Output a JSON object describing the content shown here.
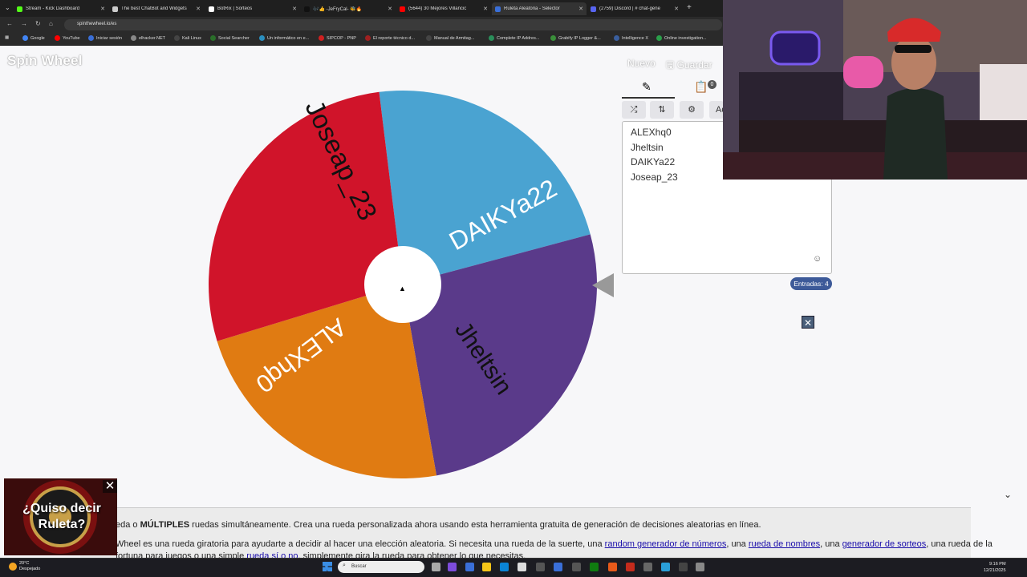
{
  "browser": {
    "tabs": [
      {
        "title": "Stream - Kick Dashboard",
        "color": "#53fc18"
      },
      {
        "title": "The best ChatBot and Widgets",
        "color": "#cccccc"
      },
      {
        "title": "BotRix | Sorteos",
        "color": "#ffffff"
      },
      {
        "title": "🎶👍 -JeFryCal- 🐝🔥",
        "color": "#111111"
      },
      {
        "title": "(5644) 30 Mejores Villancic",
        "color": "#ff0000"
      },
      {
        "title": "Ruleta Aleatoria - Selector",
        "color": "#3a6fd8"
      },
      {
        "title": "(2759) Discord | # chat-gene",
        "color": "#5865f2"
      }
    ],
    "url": "spinthewheel.io/es",
    "bookmarks": [
      "Google",
      "YouTube",
      "Iniciar sesión",
      "elhacker.NET",
      "Kali Linux",
      "Social Searcher",
      "Un informático en e...",
      "SIPCOP - PNP",
      "El reporte técnico d...",
      "Manual de Armitag...",
      "Complete IP Addres...",
      "Grabify IP Logger &...",
      "Intelligence X",
      "Online investigation..."
    ]
  },
  "app": {
    "logo": "Spin Wheel",
    "new_label": "Nuevo",
    "save_label": "Guardar"
  },
  "wheel": {
    "segments": [
      {
        "label": "Joseap_23",
        "color": "#4aa3d1"
      },
      {
        "label": "DAIKYa22",
        "color": "#5a3a8a"
      },
      {
        "label": "Jheltsin",
        "color": "#e07b12"
      },
      {
        "label": "ALEXhq0",
        "color": "#d0142a"
      }
    ]
  },
  "panel": {
    "edit_icon": "pencil-icon",
    "results_icon": "clipboard-icon",
    "results_badge": "0",
    "tools": [
      "shuffle-icon",
      "sort-icon",
      "settings-icon"
    ],
    "tool_partial": "Ad",
    "entries": [
      "ALEXhq0",
      "Jheltsin",
      "DAIKYa22",
      "Joseap_23"
    ],
    "count_label": "Entradas: 4"
  },
  "description": {
    "line1_start": "eda o ",
    "line1_bold": "MÚLTIPLES",
    "line1_end": " ruedas simultáneamente. Crea una rueda personalizada ahora usando esta herramienta gratuita de generación de decisiones aleatorias en línea.",
    "line2_start": "Wheel es una rueda giratoria para ayudarte a decidir al hacer una elección aleatoria. Si necesita una rueda de la suerte, una ",
    "link1": "random generador de números",
    "sep1": ", una ",
    "link2": "rueda de nombres",
    "sep2": ", una ",
    "link3": "generador de sorteos",
    "line2_end": ", una rueda de la",
    "line3_start": "fortuna para juegos o una simple ",
    "link4": "rueda sí o no",
    "line3_end": ", simplemente gira la rueda para obtener lo que necesitas."
  },
  "ad": {
    "line1": "¿Quiso decir",
    "line2": "Ruleta?"
  },
  "taskbar": {
    "temp": "20°C",
    "weather": "Despejado",
    "search_placeholder": "Buscar",
    "time": "9:16 PM",
    "date": "12/21/2025"
  }
}
